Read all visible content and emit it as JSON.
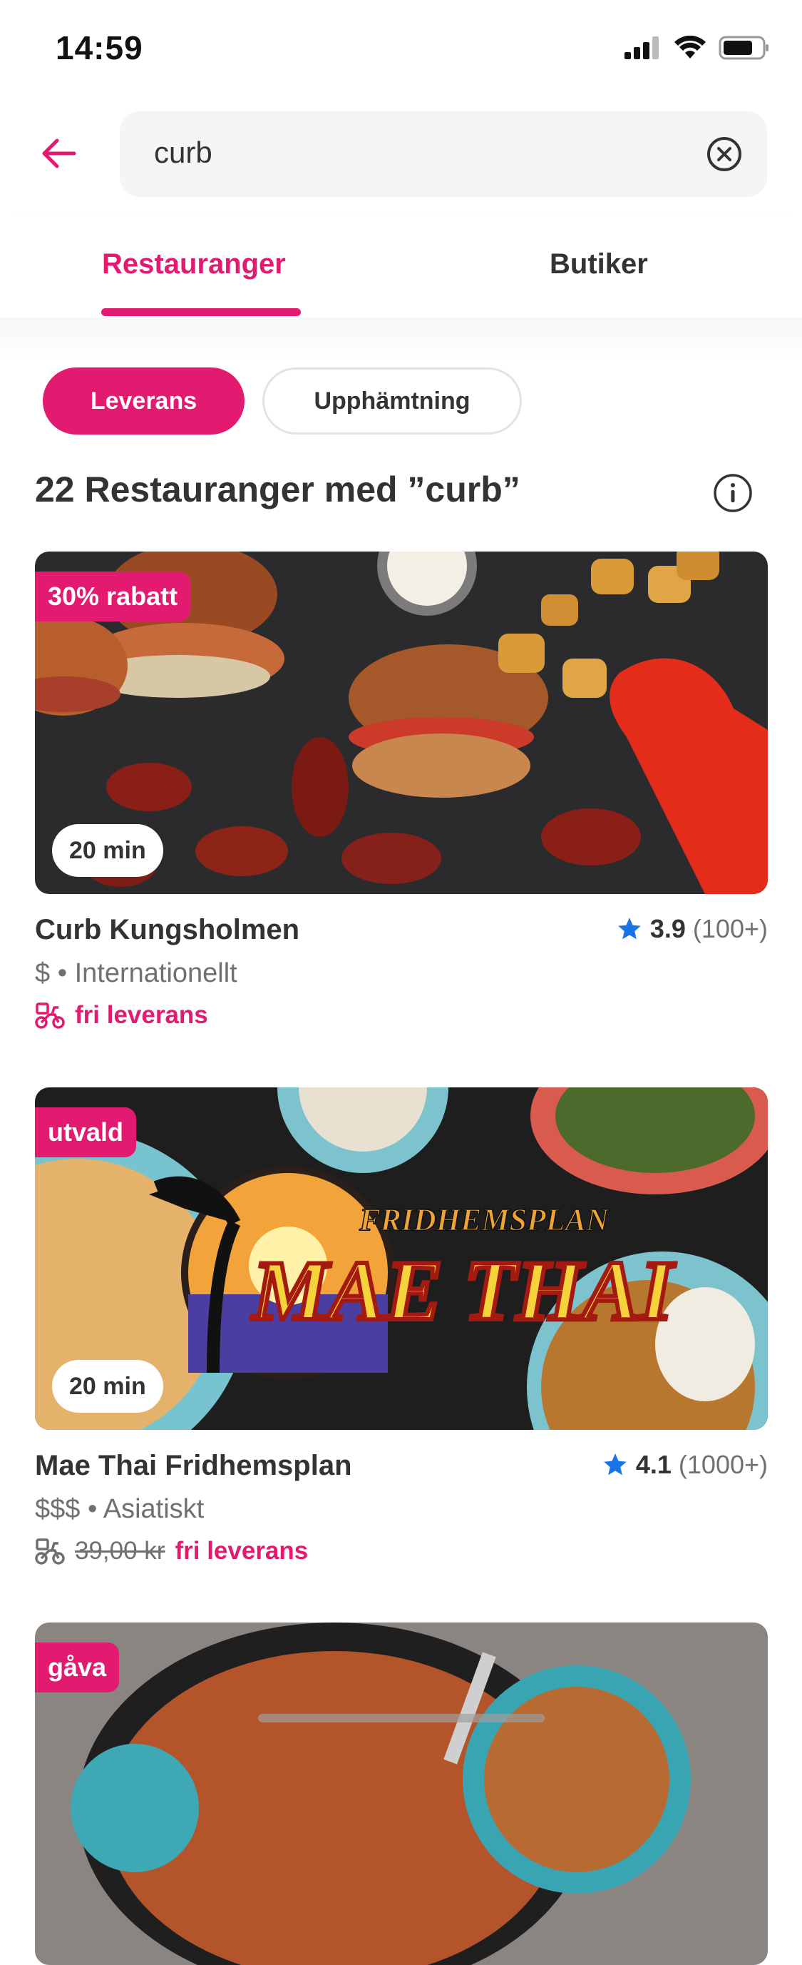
{
  "status_bar": {
    "time": "14:59"
  },
  "search": {
    "query": "curb"
  },
  "tabs": [
    {
      "label": "Restauranger",
      "active": true
    },
    {
      "label": "Butiker",
      "active": false
    }
  ],
  "filters": [
    {
      "label": "Leverans",
      "active": true
    },
    {
      "label": "Upphämtning",
      "active": false
    }
  ],
  "results_title": "22 Restauranger med ”curb”",
  "restaurants": [
    {
      "badge": "30% rabatt",
      "time": "20 min",
      "name": "Curb Kungsholmen",
      "rating": "3.9",
      "rating_count": "(100+)",
      "price": "$",
      "cuisine": "Internationellt",
      "old_fee": "",
      "delivery": "fri leverans",
      "image_icon": "burger-wings-photo"
    },
    {
      "badge": "utvald",
      "time": "20 min",
      "name": "Mae Thai Fridhemsplan",
      "rating": "4.1",
      "rating_count": "(1000+)",
      "price": "$$$",
      "cuisine": "Asiatiskt",
      "old_fee": "39,00 kr",
      "delivery": "fri leverans",
      "logo_top": "FRIDHEMSPLAN",
      "logo_main": "MAE THAI",
      "image_icon": "thai-food-photo"
    },
    {
      "badge": "gåva",
      "image_icon": "curry-pan-photo"
    }
  ],
  "colors": {
    "accent": "#e21b70",
    "star": "#1a73e8",
    "text": "#333333",
    "muted": "#707070"
  }
}
